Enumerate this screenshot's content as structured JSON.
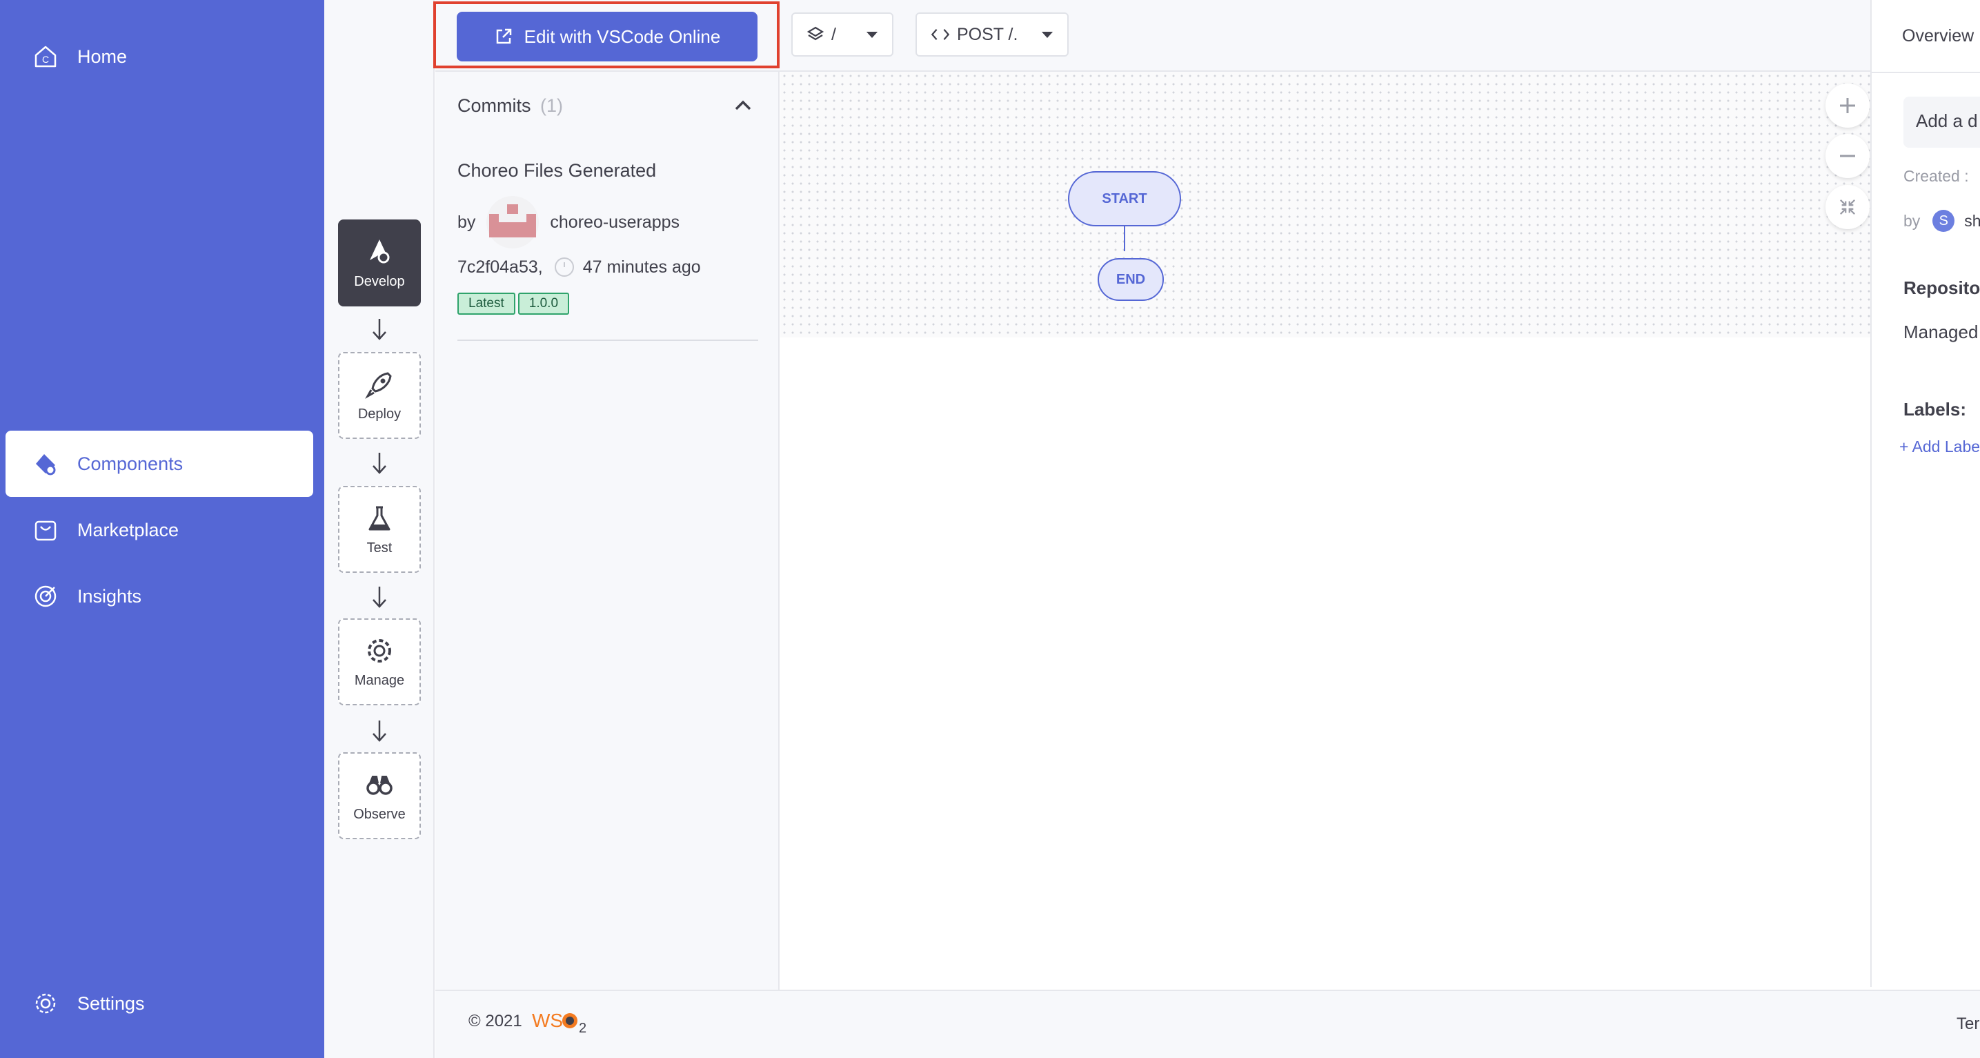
{
  "sidebar": {
    "items": [
      {
        "label": "Home",
        "icon": "home-icon"
      },
      {
        "label": "Components",
        "icon": "components-icon",
        "active": true
      },
      {
        "label": "Marketplace",
        "icon": "marketplace-icon"
      },
      {
        "label": "Insights",
        "icon": "insights-icon"
      },
      {
        "label": "Settings",
        "icon": "settings-icon"
      }
    ]
  },
  "stepper": {
    "steps": [
      {
        "label": "Develop",
        "icon": "develop-icon",
        "active": true
      },
      {
        "label": "Deploy",
        "icon": "rocket-icon"
      },
      {
        "label": "Test",
        "icon": "flask-icon"
      },
      {
        "label": "Manage",
        "icon": "gear-icon"
      },
      {
        "label": "Observe",
        "icon": "binoculars-icon"
      }
    ]
  },
  "toolbar": {
    "edit_label": "Edit with VSCode Online",
    "path_select": "/",
    "resource_select": "POST /."
  },
  "commits": {
    "title": "Commits",
    "count": "(1)",
    "items": [
      {
        "message": "Choreo Files Generated",
        "by": "by",
        "author": "choreo-userapps",
        "hash": "7c2f04a53,",
        "time": "47 minutes ago",
        "tags": [
          "Latest",
          "1.0.0"
        ]
      }
    ]
  },
  "diagram": {
    "start_label": "START",
    "end_label": "END"
  },
  "overview": {
    "title": "Overview",
    "description_placeholder": "Add a d",
    "created": "Created :",
    "by": "by",
    "avatar_letter": "S",
    "creator": "sh",
    "repository_heading": "Reposito",
    "repository_value": "Managed",
    "labels_heading": "Labels:",
    "add_label": "+ Add Labe"
  },
  "footer": {
    "copyright": "© 2021",
    "brand": "WSO2",
    "terms": "Ter"
  },
  "colors": {
    "brand": "#5567d5",
    "highlight": "#e0412f",
    "tag_green": "#2fa36b"
  }
}
